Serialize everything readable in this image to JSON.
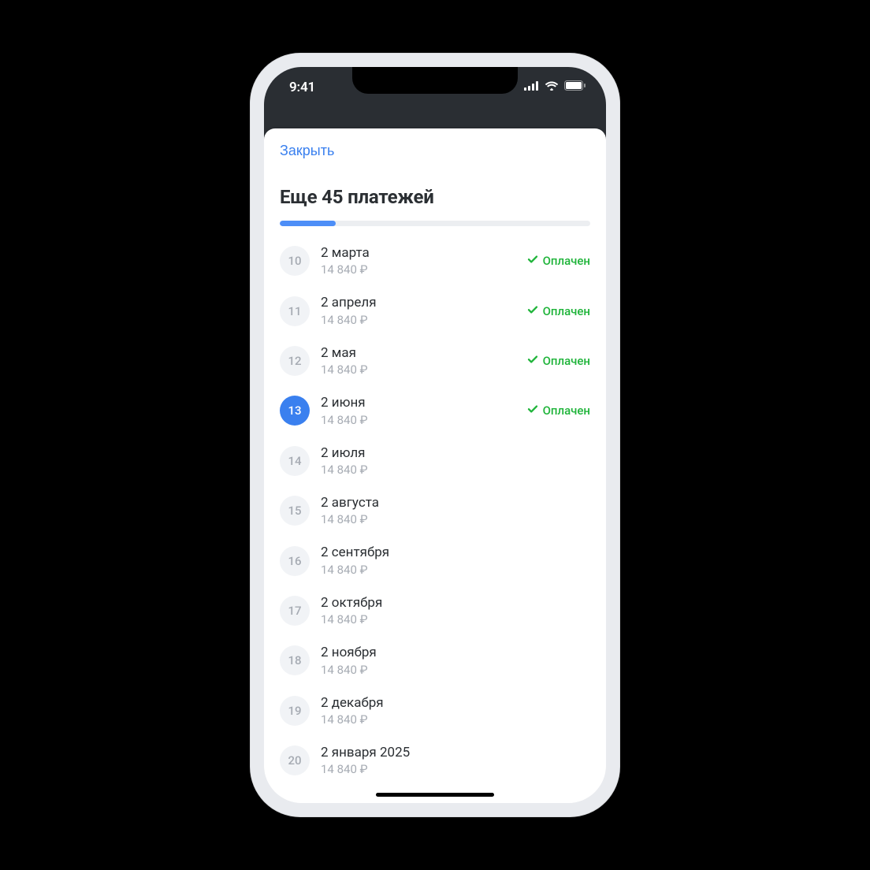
{
  "statusbar": {
    "time": "9:41"
  },
  "sheet": {
    "close_label": "Закрыть",
    "title": "Еще 45 платежей",
    "progress_percent": 18
  },
  "status_label": "Оплачен",
  "payments": [
    {
      "n": "10",
      "date": "2 марта",
      "amount": "14 840 ₽",
      "paid": true,
      "active": false
    },
    {
      "n": "11",
      "date": "2 апреля",
      "amount": "14 840 ₽",
      "paid": true,
      "active": false
    },
    {
      "n": "12",
      "date": "2 мая",
      "amount": "14 840 ₽",
      "paid": true,
      "active": false
    },
    {
      "n": "13",
      "date": "2 июня",
      "amount": "14 840 ₽",
      "paid": true,
      "active": true
    },
    {
      "n": "14",
      "date": "2 июля",
      "amount": "14 840 ₽",
      "paid": false,
      "active": false
    },
    {
      "n": "15",
      "date": "2 августа",
      "amount": "14 840 ₽",
      "paid": false,
      "active": false
    },
    {
      "n": "16",
      "date": "2 сентября",
      "amount": "14 840 ₽",
      "paid": false,
      "active": false
    },
    {
      "n": "17",
      "date": "2 октября",
      "amount": "14 840 ₽",
      "paid": false,
      "active": false
    },
    {
      "n": "18",
      "date": "2 ноября",
      "amount": "14 840 ₽",
      "paid": false,
      "active": false
    },
    {
      "n": "19",
      "date": "2 декабря",
      "amount": "14 840 ₽",
      "paid": false,
      "active": false
    },
    {
      "n": "20",
      "date": "2 января 2025",
      "amount": "14 840 ₽",
      "paid": false,
      "active": false
    }
  ]
}
